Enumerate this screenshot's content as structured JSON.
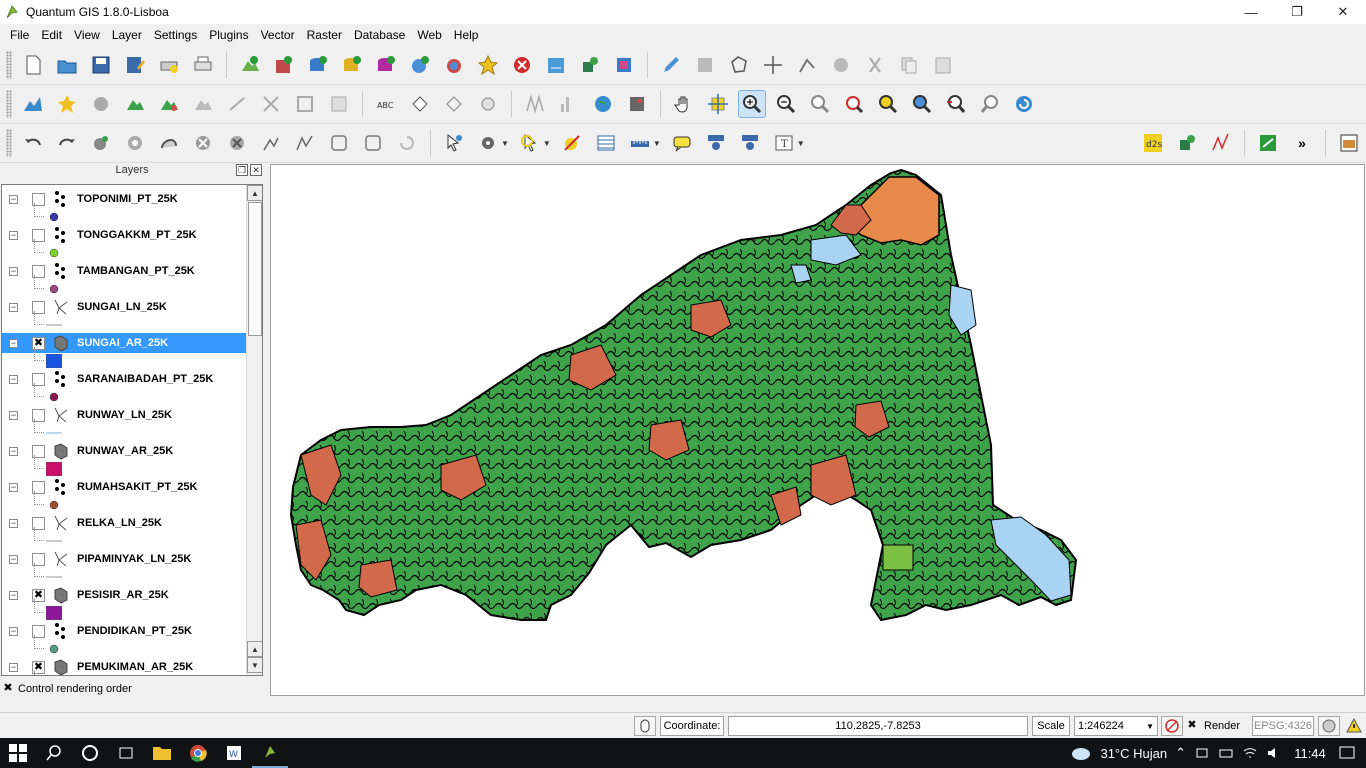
{
  "window": {
    "title": "Quantum GIS 1.8.0-Lisboa"
  },
  "menu": [
    "File",
    "Edit",
    "View",
    "Layer",
    "Settings",
    "Plugins",
    "Vector",
    "Raster",
    "Database",
    "Web",
    "Help"
  ],
  "layers_panel": {
    "title": "Layers",
    "layers": [
      {
        "name": "TOPONIMI_PT_25K",
        "type": "point",
        "checked": false,
        "legend_color": "#3a3aa8",
        "selected": false
      },
      {
        "name": "TONGGAKKM_PT_25K",
        "type": "point",
        "checked": false,
        "legend_color": "#7bd12a",
        "selected": false
      },
      {
        "name": "TAMBANGAN_PT_25K",
        "type": "point",
        "checked": false,
        "legend_color": "#9a4a80",
        "selected": false
      },
      {
        "name": "SUNGAI_LN_25K",
        "type": "line",
        "checked": false,
        "legend_color": "#9a9a9a",
        "selected": false
      },
      {
        "name": "SUNGAI_AR_25K",
        "type": "polygon",
        "checked": true,
        "legend_color": "#1a54e0",
        "selected": true
      },
      {
        "name": "SARANAIBADAH_PT_25K",
        "type": "point",
        "checked": false,
        "legend_color": "#8a1a55",
        "selected": false
      },
      {
        "name": "RUNWAY_LN_25K",
        "type": "line",
        "checked": false,
        "legend_color": "#7ab6d8",
        "selected": false
      },
      {
        "name": "RUNWAY_AR_25K",
        "type": "polygon",
        "checked": false,
        "legend_color": "#c8106a",
        "selected": false
      },
      {
        "name": "RUMAHSAKIT_PT_25K",
        "type": "point",
        "checked": false,
        "legend_color": "#a05030",
        "selected": false
      },
      {
        "name": "RELKA_LN_25K",
        "type": "line",
        "checked": false,
        "legend_color": "#9a9a9a",
        "selected": false
      },
      {
        "name": "PIPAMINYAK_LN_25K",
        "type": "line",
        "checked": false,
        "legend_color": "#9a9a9a",
        "selected": false
      },
      {
        "name": "PESISIR_AR_25K",
        "type": "polygon",
        "checked": true,
        "legend_color": "#8a1a9a",
        "selected": false
      },
      {
        "name": "PENDIDIKAN_PT_25K",
        "type": "point",
        "checked": false,
        "legend_color": "#5a9a8a",
        "selected": false
      },
      {
        "name": "PEMUKIMAN_AR_25K",
        "type": "polygon",
        "checked": true,
        "legend_color": "#888888",
        "selected": false
      }
    ],
    "control_rendering_order": {
      "label": "Control rendering order",
      "checked": true
    }
  },
  "map": {
    "colors": {
      "forest": "#3fa34a",
      "settlement": "#d2694a",
      "water": "#a9d3f2",
      "highland": "#e6894a",
      "outline": "#000000"
    }
  },
  "statusbar": {
    "coordinate_label": "Coordinate:",
    "coordinate_value": "110.2825,-7.8253",
    "scale_label": "Scale",
    "scale_value": "1:246224",
    "render_label": "Render",
    "render_checked": true,
    "crs": "EPSG:4326"
  },
  "taskbar": {
    "weather": "31°C  Hujan",
    "time": "11:44"
  }
}
